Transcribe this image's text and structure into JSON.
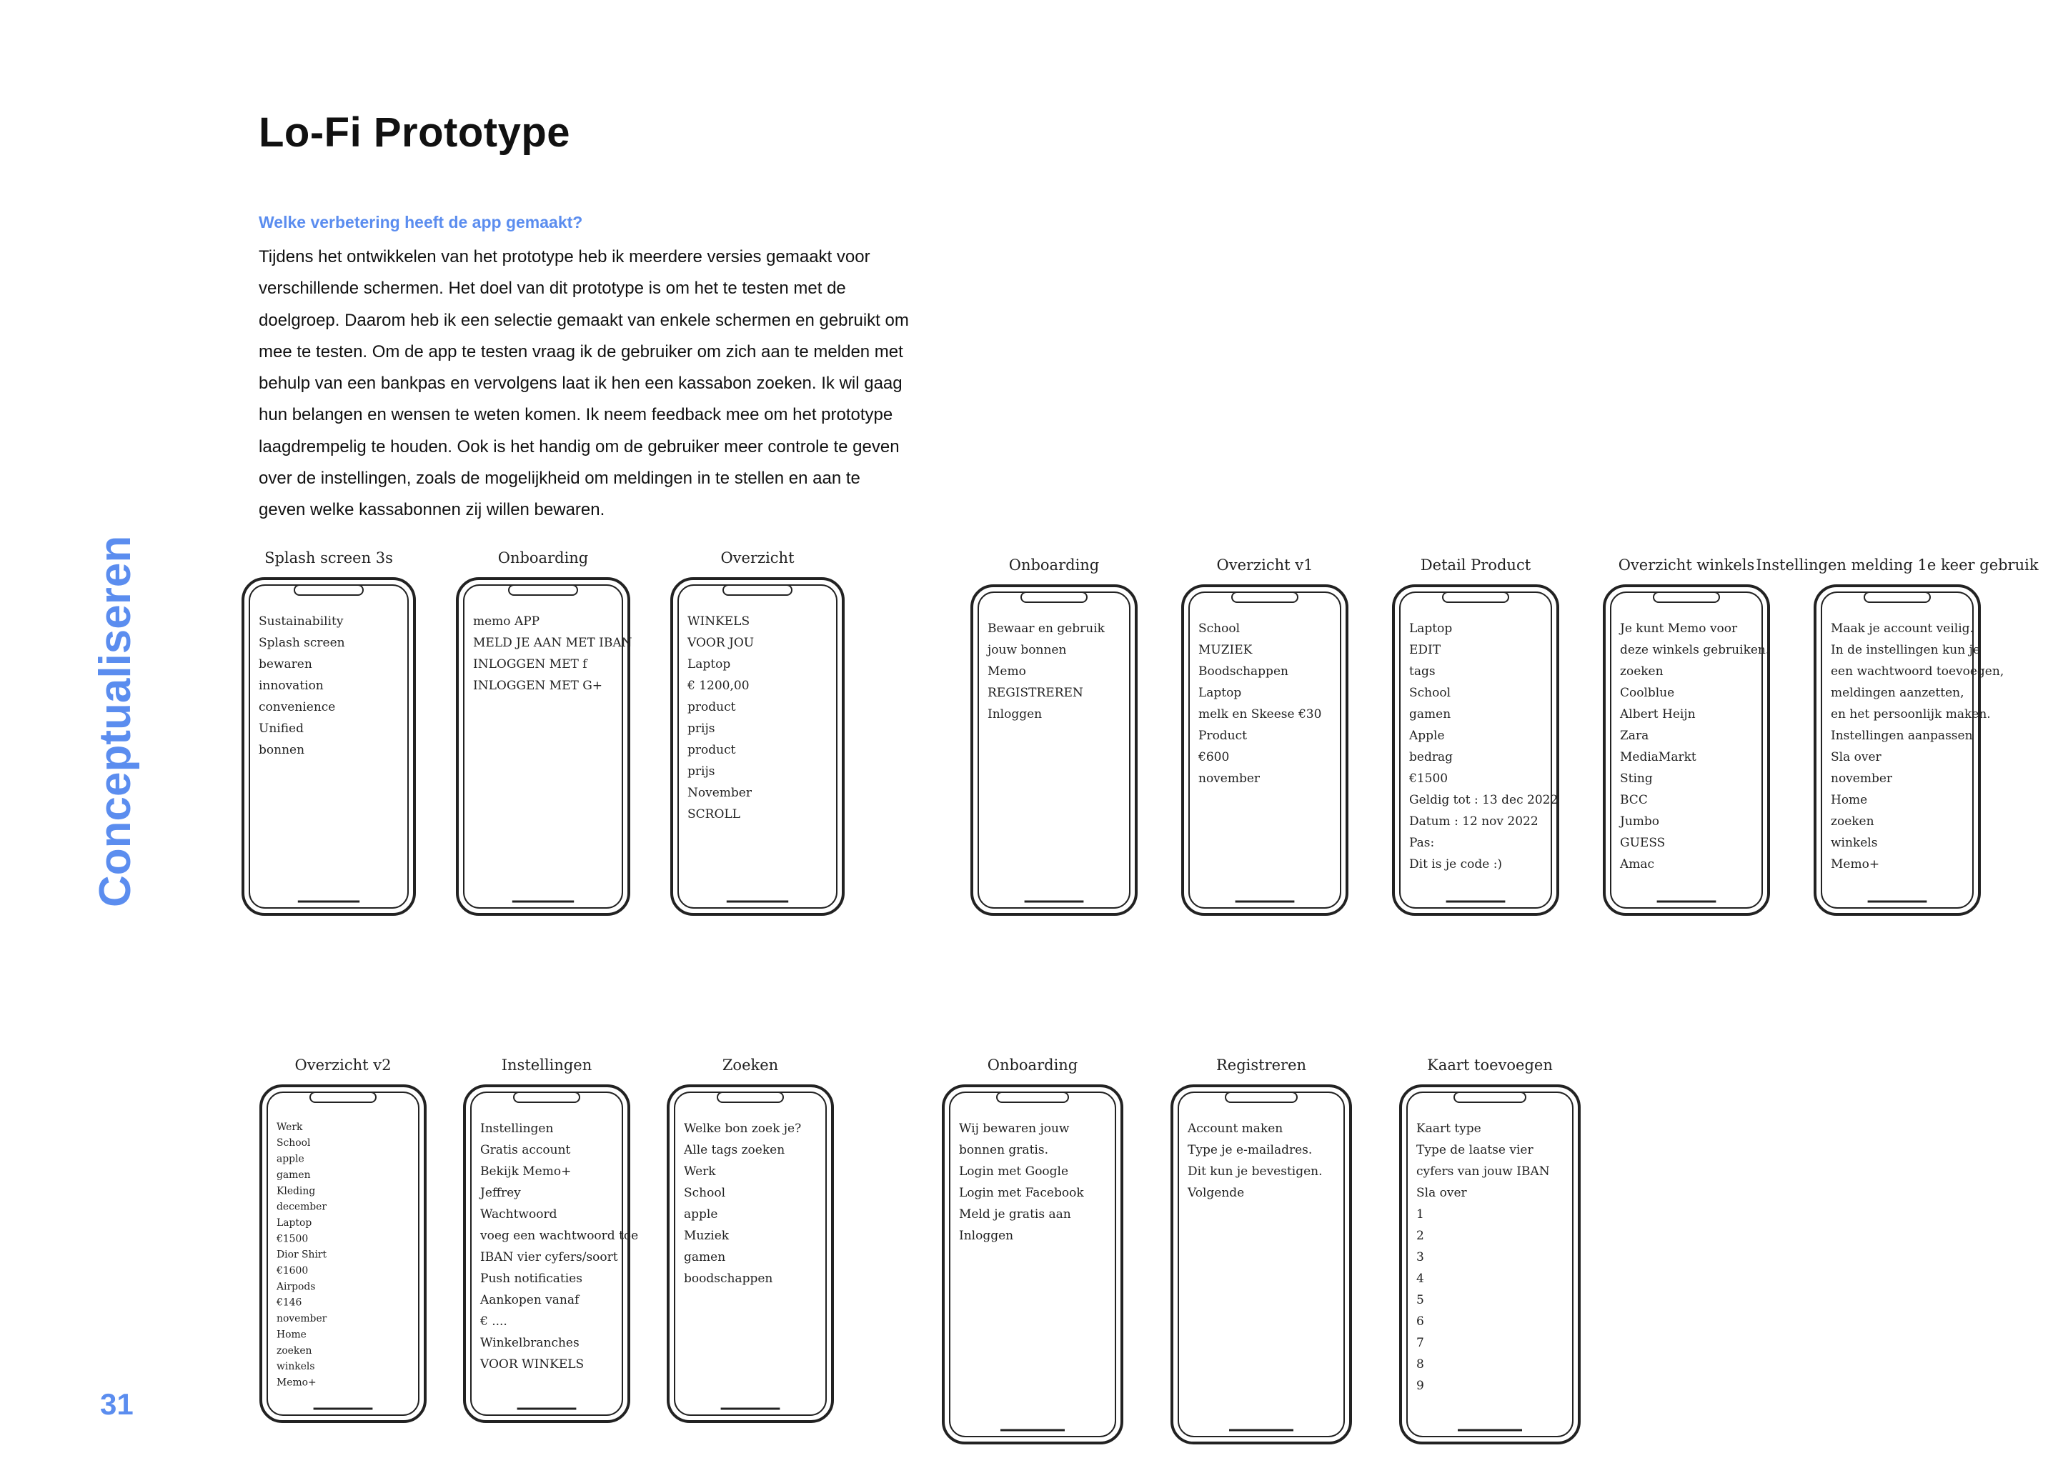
{
  "title": "Lo-Fi Prototype",
  "section": {
    "heading": "Welke verbetering heeft de app gemaakt?",
    "lines": [
      "Tijdens het ontwikkelen van het prototype heb ik meerdere versies gemaakt voor",
      "verschillende schermen. Het doel van dit prototype is om het te testen met de",
      "doelgroep. Daarom heb ik een selectie gemaakt van enkele schermen en gebruikt om",
      "mee te testen. Om de app te testen vraag ik de gebruiker om zich aan te melden met",
      "behulp van een bankpas en vervolgens laat ik hen een kassabon zoeken. Ik wil gaag",
      "hun belangen en wensen te weten komen. Ik neem feedback mee om het prototype",
      "laagdrempelig te houden. Ook is het handig om de gebruiker meer controle te geven",
      "over de instellingen, zoals de mogelijkheid om meldingen in te stellen en aan te",
      "geven welke kassabonnen zij willen bewaren."
    ]
  },
  "sidebar": {
    "label": "Conceptualiseren"
  },
  "page_number": "31",
  "sketches": {
    "row1_left": [
      {
        "title": "Splash screen 3s",
        "lines": [
          "Sustainability",
          "Splash screen",
          "bewaren",
          "innovation",
          "convenience",
          "Unified",
          "bonnen"
        ]
      },
      {
        "title": "Onboarding",
        "lines": [
          "memo APP",
          "MELD JE AAN MET IBAN",
          "INLOGGEN MET f",
          "INLOGGEN MET G+"
        ]
      },
      {
        "title": "Overzicht",
        "lines": [
          "WINKELS",
          "VOOR JOU",
          "Laptop",
          "€ 1200,00",
          "product",
          "prijs",
          "product",
          "prijs",
          "November",
          "SCROLL"
        ]
      }
    ],
    "row1_right": [
      {
        "title": "Onboarding",
        "lines": [
          "Bewaar en gebruik",
          "jouw bonnen",
          "Memo",
          "REGISTREREN",
          "Inloggen"
        ]
      },
      {
        "title": "Overzicht v1",
        "lines": [
          "School",
          "MUZIEK",
          "Boodschappen",
          "Laptop",
          "melk en Skeese €30",
          "Product",
          "€600",
          "november"
        ]
      },
      {
        "title": "Detail Product",
        "lines": [
          "Laptop",
          "EDIT",
          "tags",
          "School",
          "gamen",
          "Apple",
          "bedrag",
          "€1500",
          "Geldig tot : 13 dec 2022",
          "Datum : 12 nov 2022",
          "Pas:",
          "Dit is je code :)"
        ]
      },
      {
        "title": "Overzicht winkels",
        "lines": [
          "Je kunt Memo voor",
          "deze winkels gebruiken.",
          "zoeken",
          "Coolblue",
          "Albert Heijn",
          "Zara",
          "MediaMarkt",
          "Sting",
          "BCC",
          "Jumbo",
          "GUESS",
          "Amac"
        ]
      },
      {
        "title": "Instellingen melding 1e keer gebruik",
        "lines": [
          "Maak je account veilig.",
          "In de instellingen kun je",
          "een wachtwoord toevoegen,",
          "meldingen aanzetten,",
          "en het persoonlijk maken.",
          "Instellingen aanpassen",
          "Sla over",
          "november",
          "Home",
          "zoeken",
          "winkels",
          "Memo+"
        ]
      }
    ],
    "row2_left": [
      {
        "title": "Overzicht v2",
        "lines": [
          "Werk",
          "School",
          "apple",
          "gamen",
          "Kleding",
          "december",
          "Laptop",
          "€1500",
          "Dior Shirt",
          "€1600",
          "Airpods",
          "€146",
          "november",
          "Home",
          "zoeken",
          "winkels",
          "Memo+"
        ]
      },
      {
        "title": "Instellingen",
        "lines": [
          "Instellingen",
          "Gratis account",
          "Bekijk Memo+",
          "Jeffrey",
          "Wachtwoord",
          "voeg een wachtwoord toe",
          "IBAN vier cyfers/soort",
          "Push notificaties",
          "Aankopen vanaf",
          "€ ....",
          "Winkelbranches",
          "VOOR WINKELS"
        ]
      },
      {
        "title": "Zoeken",
        "lines": [
          "Welke bon zoek je?",
          "Alle tags zoeken",
          "Werk",
          "School",
          "apple",
          "Muziek",
          "gamen",
          "boodschappen"
        ]
      }
    ],
    "row2_right": [
      {
        "title": "Onboarding",
        "lines": [
          "Wij bewaren jouw",
          "bonnen gratis.",
          "Login met Google",
          "Login met Facebook",
          "Meld je gratis aan",
          "Inloggen"
        ]
      },
      {
        "title": "Registreren",
        "lines": [
          "Account maken",
          "Type je e-mailadres.",
          "Dit kun je bevestigen.",
          "Volgende"
        ]
      },
      {
        "title": "Kaart toevoegen",
        "lines": [
          "Kaart type",
          "Type de laatse vier",
          "cyfers van jouw IBAN",
          "Sla over",
          "1",
          "2",
          "3",
          "4",
          "5",
          "6",
          "7",
          "8",
          "9"
        ]
      }
    ]
  }
}
